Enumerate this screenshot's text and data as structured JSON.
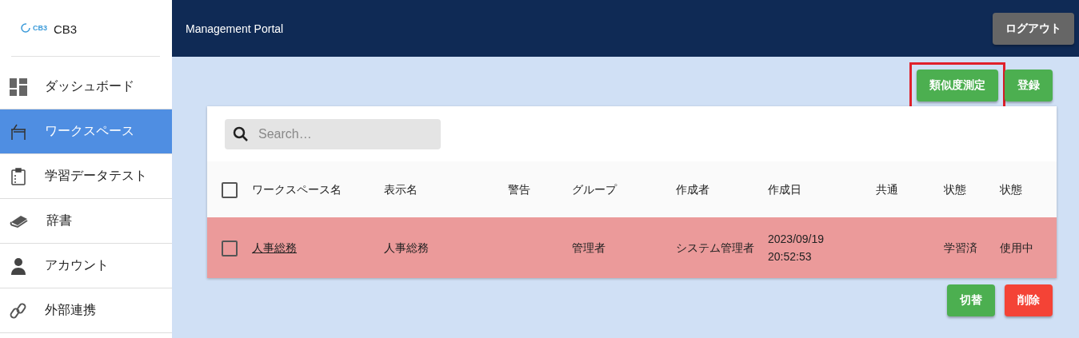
{
  "sidebar": {
    "brand": {
      "logo": "CB3",
      "name": "CB3"
    },
    "items": [
      {
        "label": "ダッシュボード",
        "selected": false
      },
      {
        "label": "ワークスペース",
        "selected": true
      },
      {
        "label": "学習データテスト",
        "selected": false
      },
      {
        "label": "辞書",
        "selected": false
      },
      {
        "label": "アカウント",
        "selected": false
      },
      {
        "label": "外部連携",
        "selected": false
      }
    ]
  },
  "header": {
    "title": "Management Portal",
    "logout": "ログアウト"
  },
  "actions": [
    {
      "label": "類似度測定",
      "highlighted": true
    },
    {
      "label": "登録",
      "highlighted": false
    }
  ],
  "search": {
    "placeholder": "Search…"
  },
  "table": {
    "select_all": {
      "checked": false
    },
    "columns": [
      "ワークスペース名",
      "表示名",
      "警告",
      "グループ",
      "作成者",
      "作成日",
      "共通",
      "状態",
      "状態"
    ],
    "rows": [
      {
        "checked": false,
        "flagged": true,
        "cells": [
          "人事総務",
          "人事総務",
          "",
          "管理者",
          "システム管理者",
          "2023/09/19 20:52:53",
          "",
          "学習済",
          "使用中"
        ]
      }
    ]
  },
  "bottom_actions": [
    {
      "label": "切替",
      "kind": "primary"
    },
    {
      "label": "削除",
      "kind": "danger"
    }
  ]
}
